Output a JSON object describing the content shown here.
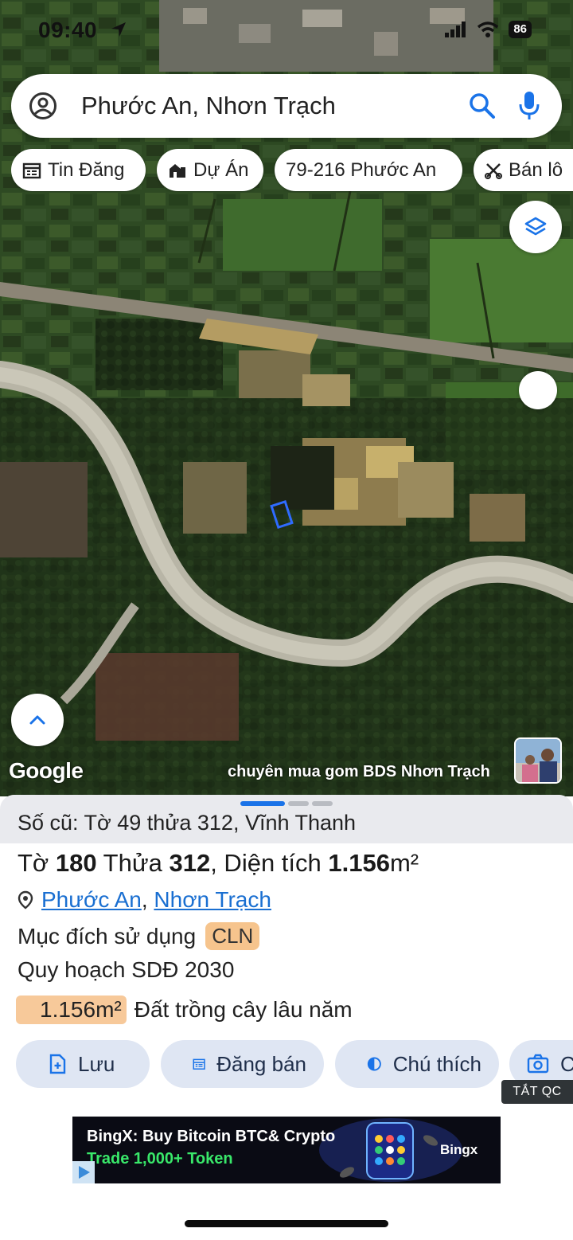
{
  "status_bar": {
    "time": "09:40",
    "battery": "86"
  },
  "search": {
    "query": "Phước An, Nhơn Trạch"
  },
  "chips": [
    {
      "label": "Tin Đăng",
      "icon": "calendar-list-icon"
    },
    {
      "label": "Dự Án",
      "icon": "building-icon"
    },
    {
      "label": "79-216 Phước An",
      "icon": ""
    },
    {
      "label": "Bán lô",
      "icon": "scissors-icon"
    }
  ],
  "map": {
    "logo": "Google",
    "caption": "chuyên mua gom BDS Nhơn Trạch"
  },
  "sheet": {
    "old_ref": "Số cũ: Tờ 49 thửa 312, Vĩnh Thanh",
    "title": {
      "to_label": "Tờ ",
      "to_value": "180",
      "thua_label": " Thửa ",
      "thua_value": "312",
      "area_label": ", Diện tích ",
      "area_value": "1.156",
      "area_unit": "m²"
    },
    "location": {
      "ward": "Phước An",
      "separator": ",",
      "district": "Nhơn Trạch"
    },
    "purpose_label": "Mục đích sử dụng",
    "purpose_code": "CLN",
    "plan": "Quy hoạch SDĐ 2030",
    "zone_area": "1.156m²",
    "zone_label": "Đất trồng cây lâu năm",
    "actions": [
      {
        "label": "Lưu",
        "icon": "add-document-icon"
      },
      {
        "label": "Đăng bán",
        "icon": "calendar-list-icon"
      },
      {
        "label": "Chú thích",
        "icon": "contrast-icon"
      },
      {
        "label": "C",
        "icon": "camera-icon"
      }
    ]
  },
  "ad_toggle": "TẮT QC",
  "ad": {
    "line1": "BingX: Buy Bitcoin BTC& Crypto",
    "line2": "Trade 1,000+ Token",
    "brand": "Bingx"
  },
  "colors": {
    "link": "#1a6fd1",
    "accent_blue": "#1a73e8",
    "chip_tag": "#f6c48d",
    "action_bg": "#dfe6f3"
  }
}
